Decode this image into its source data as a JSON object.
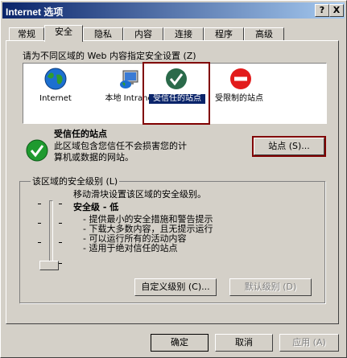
{
  "window": {
    "title": "Internet 选项",
    "help_btn": "?",
    "close_btn": "X"
  },
  "tabs": [
    "常规",
    "安全",
    "隐私",
    "内容",
    "连接",
    "程序",
    "高级"
  ],
  "active_tab": "安全",
  "zone_prompt": "请为不同区域的 Web 内容指定安全设置 (Z)",
  "zones": [
    {
      "label": "Internet",
      "icon": "globe-icon"
    },
    {
      "label": "本地 Intranet",
      "icon": "intranet-icon"
    },
    {
      "label": "受信任的站点",
      "icon": "trusted-check-icon",
      "selected": true
    },
    {
      "label": "受限制的站点",
      "icon": "restricted-icon"
    }
  ],
  "zone_info": {
    "title": "受信任的站点",
    "desc_line1": "此区域包含您信任不会损害您的计",
    "desc_line2": "算机或数据的网站。",
    "sites_button": "站点 (S)..."
  },
  "security_level": {
    "group_title": "该区域的安全级别 (L)",
    "hint": "移动滑块设置该区域的安全级别。",
    "level": "安全级 - 低",
    "bullets": [
      "- 提供最小的安全措施和警告提示",
      "- 下载大多数内容，且无提示运行",
      "- 可以运行所有的活动内容",
      "- 适用于绝对信任的站点"
    ],
    "slider_fraction": 0.0,
    "custom_button": "自定义级别 (C)...",
    "default_button": "默认级别 (D)"
  },
  "footer": {
    "ok": "确定",
    "cancel": "取消",
    "apply": "应用 (A)"
  },
  "colors": {
    "title_gradient_start": "#0a246a",
    "title_gradient_end": "#a6caf0",
    "face": "#d4d0c8",
    "focus_border": "#800000"
  }
}
